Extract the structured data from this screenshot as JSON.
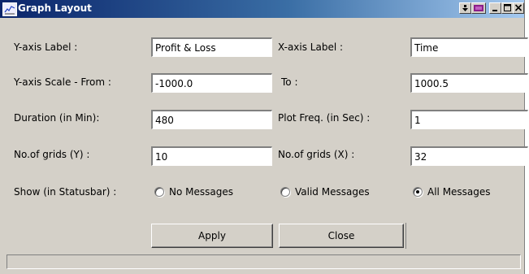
{
  "window": {
    "title": "Graph Layout"
  },
  "title_buttons": [
    "menu",
    "restore",
    "minimize",
    "maximize",
    "close"
  ],
  "form": {
    "y_axis_label": {
      "label": "Y-axis Label :",
      "value": "Profit & Loss"
    },
    "x_axis_label": {
      "label": "X-axis Label :",
      "value": "Time"
    },
    "y_scale_from": {
      "label": "Y-axis Scale -  From :",
      "value": "-1000.0"
    },
    "y_scale_to": {
      "label": "To :",
      "value": "1000.5"
    },
    "duration": {
      "label": "Duration (in Min):",
      "value": "480"
    },
    "plot_freq": {
      "label": "Plot Freq. (in Sec) :",
      "value": "1"
    },
    "grids_y": {
      "label": "No.of grids (Y) :",
      "value": "10"
    },
    "grids_x": {
      "label": "No.of grids (X) :",
      "value": "32"
    },
    "show": {
      "label": "Show (in Statusbar) :",
      "options": [
        "No Messages",
        "Valid Messages",
        "All Messages"
      ],
      "selected": "All Messages"
    }
  },
  "buttons": {
    "apply": "Apply",
    "close": "Close"
  },
  "statusbar": {
    "text": ""
  }
}
